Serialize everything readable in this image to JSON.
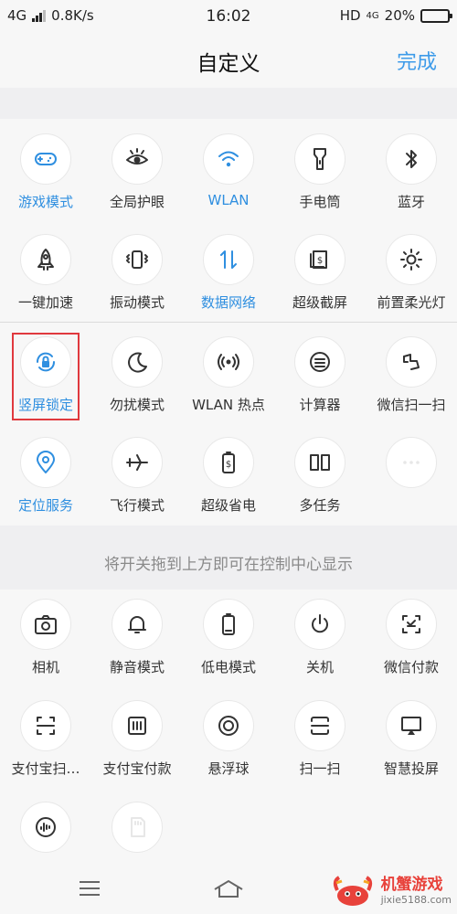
{
  "status_bar": {
    "network": "4G",
    "speed": "0.8K/s",
    "time": "16:02",
    "hd": "HD",
    "network2": "4G",
    "battery": "20%",
    "battery_level": 0.2
  },
  "header": {
    "title": "自定义",
    "done_label": "完成",
    "accent": "#3d9be9"
  },
  "active_tiles": [
    {
      "label": "游戏模式",
      "icon": "gamepad-icon",
      "on": true
    },
    {
      "label": "全局护眼",
      "icon": "eye-icon",
      "on": false
    },
    {
      "label": "WLAN",
      "icon": "wifi-icon",
      "on": true
    },
    {
      "label": "手电筒",
      "icon": "flashlight-icon",
      "on": false
    },
    {
      "label": "蓝牙",
      "icon": "bluetooth-icon",
      "on": false
    },
    {
      "label": "一键加速",
      "icon": "rocket-icon",
      "on": false
    },
    {
      "label": "振动模式",
      "icon": "vibrate-icon",
      "on": false
    },
    {
      "label": "数据网络",
      "icon": "data-network-icon",
      "on": true
    },
    {
      "label": "超级截屏",
      "icon": "screenshot-icon",
      "on": false
    },
    {
      "label": "前置柔光灯",
      "icon": "sun-icon",
      "on": false
    },
    {
      "label": "竖屏锁定",
      "icon": "rotation-lock-icon",
      "on": true
    },
    {
      "label": "勿扰模式",
      "icon": "moon-icon",
      "on": false
    },
    {
      "label": "WLAN 热点",
      "icon": "hotspot-icon",
      "on": false
    },
    {
      "label": "计算器",
      "icon": "calculator-icon",
      "on": false
    },
    {
      "label": "微信扫一扫",
      "icon": "wechat-scan-icon",
      "on": false
    },
    {
      "label": "定位服务",
      "icon": "location-icon",
      "on": true
    },
    {
      "label": "飞行模式",
      "icon": "airplane-icon",
      "on": false
    },
    {
      "label": "超级省电",
      "icon": "battery-saver-icon",
      "on": false
    },
    {
      "label": "多任务",
      "icon": "multitask-icon",
      "on": false
    },
    {
      "label": "",
      "icon": "more-icon",
      "on": false
    }
  ],
  "hint": "将开关拖到上方即可在控制中心显示",
  "available_tiles": [
    {
      "label": "相机",
      "icon": "camera-icon"
    },
    {
      "label": "静音模式",
      "icon": "bell-icon"
    },
    {
      "label": "低电模式",
      "icon": "low-battery-icon"
    },
    {
      "label": "关机",
      "icon": "power-icon"
    },
    {
      "label": "微信付款",
      "icon": "wechat-pay-icon"
    },
    {
      "label": "支付宝扫…",
      "icon": "alipay-scan-icon"
    },
    {
      "label": "支付宝付款",
      "icon": "alipay-pay-icon"
    },
    {
      "label": "悬浮球",
      "icon": "floating-ball-icon"
    },
    {
      "label": "扫一扫",
      "icon": "scan-icon"
    },
    {
      "label": "智慧投屏",
      "icon": "screencast-icon"
    },
    {
      "label": "",
      "icon": "voice-memo-icon"
    },
    {
      "label": "",
      "icon": "sd-card-icon"
    }
  ],
  "watermark": {
    "brand": "机蟹游戏",
    "url": "jixie5188.com"
  }
}
